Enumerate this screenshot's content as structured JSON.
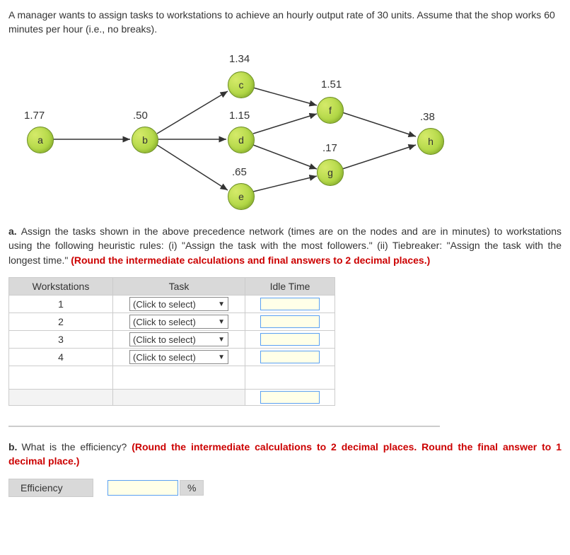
{
  "intro": "A manager wants to assign tasks to workstations to achieve an hourly output rate of 30 units. Assume that the shop works 60 minutes per hour (i.e., no breaks).",
  "nodes": {
    "a": {
      "label": "a",
      "time": "1.77"
    },
    "b": {
      "label": "b",
      "time": ".50"
    },
    "c": {
      "label": "c",
      "time": "1.34"
    },
    "d": {
      "label": "d",
      "time": "1.15"
    },
    "e": {
      "label": "e",
      "time": ".65"
    },
    "f": {
      "label": "f",
      "time": "1.51"
    },
    "g": {
      "label": "g",
      "time": ".17"
    },
    "h": {
      "label": "h",
      "time": ".38"
    }
  },
  "part_a": {
    "letter": "a.",
    "text": "Assign the tasks shown in the above precedence network (times are on the nodes and are in minutes) to workstations using the following heuristic rules: (i) \"Assign the task with the most followers.\" (ii) Tiebreaker: \"Assign the task with the longest time.\" ",
    "redtext": "(Round the intermediate calculations and final answers to 2 decimal places.)"
  },
  "table": {
    "headers": {
      "ws": "Workstations",
      "task": "Task",
      "idle": "Idle Time"
    },
    "rows": [
      {
        "ws": "1",
        "task_placeholder": "(Click to select)"
      },
      {
        "ws": "2",
        "task_placeholder": "(Click to select)"
      },
      {
        "ws": "3",
        "task_placeholder": "(Click to select)"
      },
      {
        "ws": "4",
        "task_placeholder": "(Click to select)"
      }
    ]
  },
  "part_b": {
    "letter": "b.",
    "text": "What is the efficiency? ",
    "redtext": "(Round the intermediate calculations to 2 decimal places. Round the final answer to 1 decimal place.)"
  },
  "efficiency": {
    "label": "Efficiency",
    "unit": "%"
  },
  "chart_data": {
    "type": "precedence-network",
    "nodes": [
      {
        "id": "a",
        "time": 1.77
      },
      {
        "id": "b",
        "time": 0.5
      },
      {
        "id": "c",
        "time": 1.34
      },
      {
        "id": "d",
        "time": 1.15
      },
      {
        "id": "e",
        "time": 0.65
      },
      {
        "id": "f",
        "time": 1.51
      },
      {
        "id": "g",
        "time": 0.17
      },
      {
        "id": "h",
        "time": 0.38
      }
    ],
    "edges": [
      [
        "a",
        "b"
      ],
      [
        "b",
        "c"
      ],
      [
        "b",
        "d"
      ],
      [
        "b",
        "e"
      ],
      [
        "c",
        "f"
      ],
      [
        "d",
        "f"
      ],
      [
        "d",
        "g"
      ],
      [
        "e",
        "g"
      ],
      [
        "f",
        "h"
      ],
      [
        "g",
        "h"
      ]
    ]
  }
}
